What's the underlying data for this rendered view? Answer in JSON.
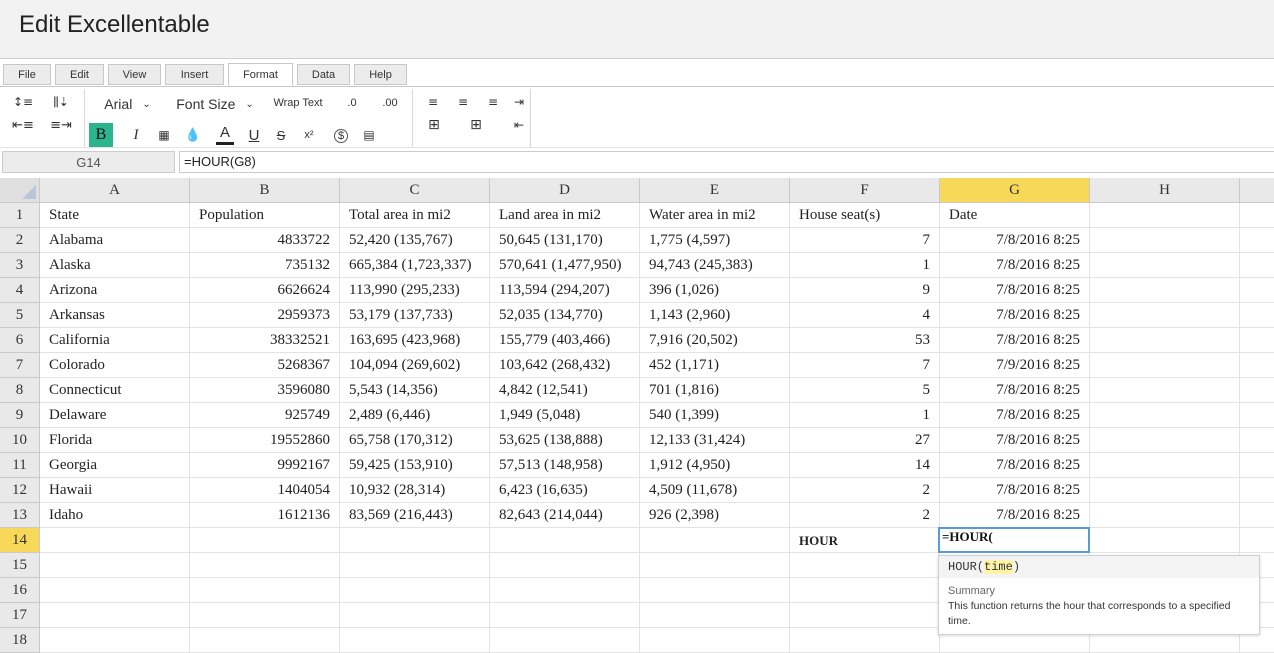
{
  "app": {
    "title": "Edit Excellentable"
  },
  "tabs": [
    {
      "label": "File"
    },
    {
      "label": "Edit"
    },
    {
      "label": "View"
    },
    {
      "label": "Insert"
    },
    {
      "label": "Format",
      "active": true
    },
    {
      "label": "Data"
    },
    {
      "label": "Help"
    }
  ],
  "toolbar": {
    "font_family": "Arial",
    "font_size": "Font Size",
    "wrap_text": "Wrap Text",
    "decrease_decimal": ".0",
    "increase_decimal": ".00",
    "bold": "B",
    "italic": "I",
    "font_color": "A",
    "underline": "U",
    "strikethrough": "S",
    "superscript": "x²",
    "currency": "$",
    "accent_color": "#2bb58f"
  },
  "formula_bar": {
    "cell_ref": "G14",
    "formula": "=HOUR(G8)"
  },
  "grid": {
    "columns": [
      "A",
      "B",
      "C",
      "D",
      "E",
      "F",
      "G",
      "H"
    ],
    "selected_column": "G",
    "rows": [
      "1",
      "2",
      "3",
      "4",
      "5",
      "6",
      "7",
      "8",
      "9",
      "10",
      "11",
      "12",
      "13",
      "14",
      "15",
      "16",
      "17",
      "18"
    ],
    "selected_row": "14",
    "data": [
      [
        "State",
        "Population",
        "Total area in mi2",
        "Land area in mi2",
        "Water area in mi2",
        "House seat(s)",
        "Date",
        ""
      ],
      [
        "Alabama",
        "4833722",
        "52,420 (135,767)",
        "50,645 (131,170)",
        "1,775 (4,597)",
        "7",
        "7/8/2016 8:25",
        ""
      ],
      [
        "Alaska",
        "735132",
        "665,384 (1,723,337)",
        "570,641 (1,477,950)",
        "94,743 (245,383)",
        "1",
        "7/8/2016 8:25",
        ""
      ],
      [
        "Arizona",
        "6626624",
        "113,990 (295,233)",
        "113,594 (294,207)",
        "396 (1,026)",
        "9",
        "7/8/2016 8:25",
        ""
      ],
      [
        "Arkansas",
        "2959373",
        "53,179 (137,733)",
        "52,035 (134,770)",
        "1,143 (2,960)",
        "4",
        "7/8/2016 8:25",
        ""
      ],
      [
        "California",
        "38332521",
        "163,695 (423,968)",
        "155,779 (403,466)",
        "7,916 (20,502)",
        "53",
        "7/8/2016 8:25",
        ""
      ],
      [
        "Colorado",
        "5268367",
        "104,094 (269,602)",
        "103,642 (268,432)",
        "452 (1,171)",
        "7",
        "7/9/2016 8:25",
        ""
      ],
      [
        "Connecticut",
        "3596080",
        "5,543 (14,356)",
        "4,842 (12,541)",
        "701 (1,816)",
        "5",
        "7/8/2016 8:25",
        ""
      ],
      [
        "Delaware",
        "925749",
        "2,489 (6,446)",
        "1,949 (5,048)",
        "540 (1,399)",
        "1",
        "7/8/2016 8:25",
        ""
      ],
      [
        "Florida",
        "19552860",
        "65,758 (170,312)",
        "53,625 (138,888)",
        "12,133 (31,424)",
        "27",
        "7/8/2016 8:25",
        ""
      ],
      [
        "Georgia",
        "9992167",
        "59,425 (153,910)",
        "57,513 (148,958)",
        "1,912 (4,950)",
        "14",
        "7/8/2016 8:25",
        ""
      ],
      [
        "Hawaii",
        "1404054",
        "10,932 (28,314)",
        "6,423 (16,635)",
        "4,509 (11,678)",
        "2",
        "7/8/2016 8:25",
        ""
      ],
      [
        "Idaho",
        "1612136",
        "83,569 (216,443)",
        "82,643 (214,044)",
        "926 (2,398)",
        "2",
        "7/8/2016 8:25",
        ""
      ],
      [
        "",
        "",
        "",
        "",
        "",
        "HOUR",
        "=HOUR(",
        ""
      ],
      [
        "",
        "",
        "",
        "",
        "",
        "",
        "",
        ""
      ],
      [
        "",
        "",
        "",
        "",
        "",
        "",
        "",
        ""
      ],
      [
        "",
        "",
        "",
        "",
        "",
        "",
        "",
        ""
      ],
      [
        "",
        "",
        "",
        "",
        "",
        "",
        "",
        ""
      ]
    ],
    "right_aligned_columns": [
      1,
      5,
      6
    ]
  },
  "tooltip": {
    "fn_name": "HOUR(",
    "arg": "time",
    "close_paren": ")",
    "summary_heading": "Summary",
    "summary": "This function returns the hour that corresponds to a specified time."
  }
}
